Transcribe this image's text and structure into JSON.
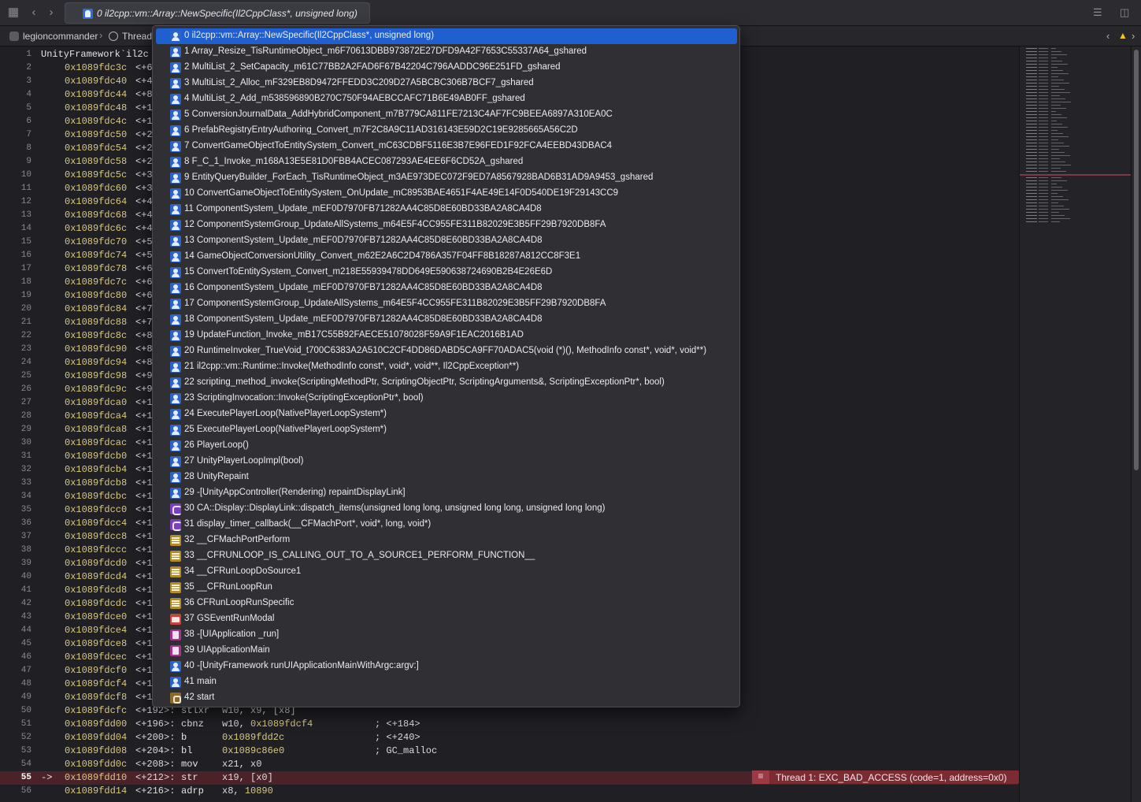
{
  "tabbar": {
    "tab_title": "0 il2cpp::vm::Array::NewSpecific(Il2CppClass*, unsigned long)"
  },
  "jumpbar": {
    "project": "legioncommander",
    "thread": "Thread"
  },
  "editor": {
    "header_text": "UnityFramework`il2c",
    "current_line_arrow": "->",
    "lines": [
      {
        "n": "1"
      },
      {
        "n": "2",
        "addr": "0x1089fdc3c",
        "off": "<+6"
      },
      {
        "n": "3",
        "addr": "0x1089fdc40",
        "off": "<+4"
      },
      {
        "n": "4",
        "addr": "0x1089fdc44",
        "off": "<+8"
      },
      {
        "n": "5",
        "addr": "0x1089fdc48",
        "off": "<+1"
      },
      {
        "n": "6",
        "addr": "0x1089fdc4c",
        "off": "<+1"
      },
      {
        "n": "7",
        "addr": "0x1089fdc50",
        "off": "<+2"
      },
      {
        "n": "8",
        "addr": "0x1089fdc54",
        "off": "<+2"
      },
      {
        "n": "9",
        "addr": "0x1089fdc58",
        "off": "<+2"
      },
      {
        "n": "10",
        "addr": "0x1089fdc5c",
        "off": "<+3"
      },
      {
        "n": "11",
        "addr": "0x1089fdc60",
        "off": "<+3"
      },
      {
        "n": "12",
        "addr": "0x1089fdc64",
        "off": "<+4"
      },
      {
        "n": "13",
        "addr": "0x1089fdc68",
        "off": "<+4"
      },
      {
        "n": "14",
        "addr": "0x1089fdc6c",
        "off": "<+4"
      },
      {
        "n": "15",
        "addr": "0x1089fdc70",
        "off": "<+5"
      },
      {
        "n": "16",
        "addr": "0x1089fdc74",
        "off": "<+5"
      },
      {
        "n": "17",
        "addr": "0x1089fdc78",
        "off": "<+6"
      },
      {
        "n": "18",
        "addr": "0x1089fdc7c",
        "off": "<+6"
      },
      {
        "n": "19",
        "addr": "0x1089fdc80",
        "off": "<+6"
      },
      {
        "n": "20",
        "addr": "0x1089fdc84",
        "off": "<+7"
      },
      {
        "n": "21",
        "addr": "0x1089fdc88",
        "off": "<+7"
      },
      {
        "n": "22",
        "addr": "0x1089fdc8c",
        "off": "<+8"
      },
      {
        "n": "23",
        "addr": "0x1089fdc90",
        "off": "<+8"
      },
      {
        "n": "24",
        "addr": "0x1089fdc94",
        "off": "<+8"
      },
      {
        "n": "25",
        "addr": "0x1089fdc98",
        "off": "<+9"
      },
      {
        "n": "26",
        "addr": "0x1089fdc9c",
        "off": "<+9"
      },
      {
        "n": "27",
        "addr": "0x1089fdca0",
        "off": "<+1"
      },
      {
        "n": "28",
        "addr": "0x1089fdca4",
        "off": "<+1"
      },
      {
        "n": "29",
        "addr": "0x1089fdca8",
        "off": "<+1"
      },
      {
        "n": "30",
        "addr": "0x1089fdcac",
        "off": "<+1"
      },
      {
        "n": "31",
        "addr": "0x1089fdcb0",
        "off": "<+1"
      },
      {
        "n": "32",
        "addr": "0x1089fdcb4",
        "off": "<+1"
      },
      {
        "n": "33",
        "addr": "0x1089fdcb8",
        "off": "<+1"
      },
      {
        "n": "34",
        "addr": "0x1089fdcbc",
        "off": "<+1"
      },
      {
        "n": "35",
        "addr": "0x1089fdcc0",
        "off": "<+1"
      },
      {
        "n": "36",
        "addr": "0x1089fdcc4",
        "off": "<+1"
      },
      {
        "n": "37",
        "addr": "0x1089fdcc8",
        "off": "<+1"
      },
      {
        "n": "38",
        "addr": "0x1089fdccc",
        "off": "<+1"
      },
      {
        "n": "39",
        "addr": "0x1089fdcd0",
        "off": "<+1"
      },
      {
        "n": "40",
        "addr": "0x1089fdcd4",
        "off": "<+1"
      },
      {
        "n": "41",
        "addr": "0x1089fdcd8",
        "off": "<+1"
      },
      {
        "n": "42",
        "addr": "0x1089fdcdc",
        "off": "<+1"
      },
      {
        "n": "43",
        "addr": "0x1089fdce0",
        "off": "<+1"
      },
      {
        "n": "44",
        "addr": "0x1089fdce4",
        "off": "<+1"
      },
      {
        "n": "45",
        "addr": "0x1089fdce8",
        "off": "<+1"
      },
      {
        "n": "46",
        "addr": "0x1089fdcec",
        "off": "<+1"
      },
      {
        "n": "47",
        "addr": "0x1089fdcf0",
        "off": "<+1"
      },
      {
        "n": "48",
        "addr": "0x1089fdcf4",
        "off": "<+1"
      },
      {
        "n": "49",
        "addr": "0x1089fdcf8",
        "off": "<+1"
      },
      {
        "n": "50",
        "addr": "0x1089fdcfc",
        "off": "<+192>:",
        "mn": "stlxr",
        "ops": "w10, x9, [x8]"
      },
      {
        "n": "51",
        "addr": "0x1089fdd00",
        "off": "<+196>:",
        "mn": "cbnz",
        "ops": "w10, ",
        "opnum": "0x1089fdcf4",
        "cmt": "; <+184>"
      },
      {
        "n": "52",
        "addr": "0x1089fdd04",
        "off": "<+200>:",
        "mn": "b",
        "opnum": "0x1089fdd2c",
        "cmt": "; <+240>"
      },
      {
        "n": "53",
        "addr": "0x1089fdd08",
        "off": "<+204>:",
        "mn": "bl",
        "opnum": "0x1089c86e0",
        "cmt": "; GC_malloc"
      },
      {
        "n": "54",
        "addr": "0x1089fdd0c",
        "off": "<+208>:",
        "mn": "mov",
        "ops": "x21, x0"
      },
      {
        "n": "55",
        "addr": "0x1089fdd10",
        "off": "<+212>:",
        "mn": "str",
        "ops": "x19, [x0]",
        "current": true
      },
      {
        "n": "56",
        "addr": "0x1089fdd14",
        "off": "<+216>:",
        "mn": "adrp",
        "ops": "x8, ",
        "opnum": "10890"
      }
    ],
    "exception_text": "Thread 1: EXC_BAD_ACCESS (code=1, address=0x0)"
  },
  "stack_frames": [
    {
      "label": "0 il2cpp::vm::Array::NewSpecific(Il2CppClass*, unsigned long)",
      "icon": "user-code-icon",
      "selected": true
    },
    {
      "label": "1 Array_Resize_TisRuntimeObject_m6F70613DBB973872E27DFD9A42F7653C55337A64_gshared",
      "icon": "user-code-icon"
    },
    {
      "label": "2 MultiList_2_SetCapacity_m61C77BB2A2FAD6F67B42204C796AADDC96E251FD_gshared",
      "icon": "user-code-icon"
    },
    {
      "label": "3 MultiList_2_Alloc_mF329EB8D9472FFEDD3C209D27A5BCBC306B7BCF7_gshared",
      "icon": "user-code-icon"
    },
    {
      "label": "4 MultiList_2_Add_m538596890B270C750F94AEBCCAFC71B6E49AB0FF_gshared",
      "icon": "user-code-icon"
    },
    {
      "label": "5 ConversionJournalData_AddHybridComponent_m7B779CA811FE7213C4AF7FC9BEEA6897A310EA0C",
      "icon": "user-code-icon"
    },
    {
      "label": "6 PrefabRegistryEntryAuthoring_Convert_m7F2C8A9C11AD316143E59D2C19E9285665A56C2D",
      "icon": "user-code-icon"
    },
    {
      "label": "7 ConvertGameObjectToEntitySystem_Convert_mC63CDBF5116E3B7E96FED1F92FCA4EEBD43DBAC4",
      "icon": "user-code-icon"
    },
    {
      "label": "8 F_C_1_Invoke_m168A13E5E81D0FBB4ACEC087293AE4EE6F6CD52A_gshared",
      "icon": "user-code-icon"
    },
    {
      "label": "9 EntityQueryBuilder_ForEach_TisRuntimeObject_m3AE973DEC072F9ED7A8567928BAD6B31AD9A9453_gshared",
      "icon": "user-code-icon"
    },
    {
      "label": "10 ConvertGameObjectToEntitySystem_OnUpdate_mC8953BAE4651F4AE49E14F0D540DE19F29143CC9",
      "icon": "user-code-icon"
    },
    {
      "label": "11 ComponentSystem_Update_mEF0D7970FB71282AA4C85D8E60BD33BA2A8CA4D8",
      "icon": "user-code-icon"
    },
    {
      "label": "12 ComponentSystemGroup_UpdateAllSystems_m64E5F4CC955FE311B82029E3B5FF29B7920DB8FA",
      "icon": "user-code-icon"
    },
    {
      "label": "13 ComponentSystem_Update_mEF0D7970FB71282AA4C85D8E60BD33BA2A8CA4D8",
      "icon": "user-code-icon"
    },
    {
      "label": "14 GameObjectConversionUtility_Convert_m62E2A6C2D4786A357F04FF8B18287A812CC8F3E1",
      "icon": "user-code-icon"
    },
    {
      "label": "15 ConvertToEntitySystem_Convert_m218E55939478DD649E590638724690B2B4E26E6D",
      "icon": "user-code-icon"
    },
    {
      "label": "16 ComponentSystem_Update_mEF0D7970FB71282AA4C85D8E60BD33BA2A8CA4D8",
      "icon": "user-code-icon"
    },
    {
      "label": "17 ComponentSystemGroup_UpdateAllSystems_m64E5F4CC955FE311B82029E3B5FF29B7920DB8FA",
      "icon": "user-code-icon"
    },
    {
      "label": "18 ComponentSystem_Update_mEF0D7970FB71282AA4C85D8E60BD33BA2A8CA4D8",
      "icon": "user-code-icon"
    },
    {
      "label": "19 UpdateFunction_Invoke_mB17C55B92FAECE51078028F59A9F1EAC2016B1AD",
      "icon": "user-code-icon"
    },
    {
      "label": "20 RuntimeInvoker_TrueVoid_t700C6383A2A510C2CF4DD86DABD5CA9FF70ADAC5(void (*)(), MethodInfo const*, void*, void**)",
      "icon": "user-code-icon"
    },
    {
      "label": "21 il2cpp::vm::Runtime::Invoke(MethodInfo const*, void*, void**, Il2CppException**)",
      "icon": "user-code-icon"
    },
    {
      "label": "22 scripting_method_invoke(ScriptingMethodPtr, ScriptingObjectPtr, ScriptingArguments&, ScriptingExceptionPtr*, bool)",
      "icon": "user-code-icon"
    },
    {
      "label": "23 ScriptingInvocation::Invoke(ScriptingExceptionPtr*, bool)",
      "icon": "user-code-icon"
    },
    {
      "label": "24 ExecutePlayerLoop(NativePlayerLoopSystem*)",
      "icon": "user-code-icon"
    },
    {
      "label": "25 ExecutePlayerLoop(NativePlayerLoopSystem*)",
      "icon": "user-code-icon"
    },
    {
      "label": "26 PlayerLoop()",
      "icon": "user-code-icon"
    },
    {
      "label": "27 UnityPlayerLoopImpl(bool)",
      "icon": "user-code-icon"
    },
    {
      "label": "28 UnityRepaint",
      "icon": "user-code-icon"
    },
    {
      "label": "29 -[UnityAppController(Rendering) repaintDisplayLink]",
      "icon": "user-code-icon"
    },
    {
      "label": "30 CA::Display::DisplayLink::dispatch_items(unsigned long long, unsigned long long, unsigned long long)",
      "icon": "quartzcore-icon"
    },
    {
      "label": "31 display_timer_callback(__CFMachPort*, void*, long, void*)",
      "icon": "quartzcore-icon"
    },
    {
      "label": "32 __CFMachPortPerform",
      "icon": "corefoundation-icon"
    },
    {
      "label": "33 __CFRUNLOOP_IS_CALLING_OUT_TO_A_SOURCE1_PERFORM_FUNCTION__",
      "icon": "corefoundation-icon"
    },
    {
      "label": "34 __CFRunLoopDoSource1",
      "icon": "corefoundation-icon"
    },
    {
      "label": "35 __CFRunLoopRun",
      "icon": "corefoundation-icon"
    },
    {
      "label": "36 CFRunLoopRunSpecific",
      "icon": "corefoundation-icon"
    },
    {
      "label": "37 GSEventRunModal",
      "icon": "graphicsservices-icon"
    },
    {
      "label": "38 -[UIApplication _run]",
      "icon": "uikit-icon"
    },
    {
      "label": "39 UIApplicationMain",
      "icon": "uikit-icon"
    },
    {
      "label": "40 -[UnityFramework runUIApplicationMainWithArgc:argv:]",
      "icon": "user-code-icon"
    },
    {
      "label": "41 main",
      "icon": "user-code-icon"
    },
    {
      "label": "42 start",
      "icon": "dyld-icon"
    }
  ],
  "colors": {
    "selection": "#1f5fd0",
    "address": "#d9c97c",
    "current_line": "#4b2228",
    "exception": "#7c2b33"
  }
}
